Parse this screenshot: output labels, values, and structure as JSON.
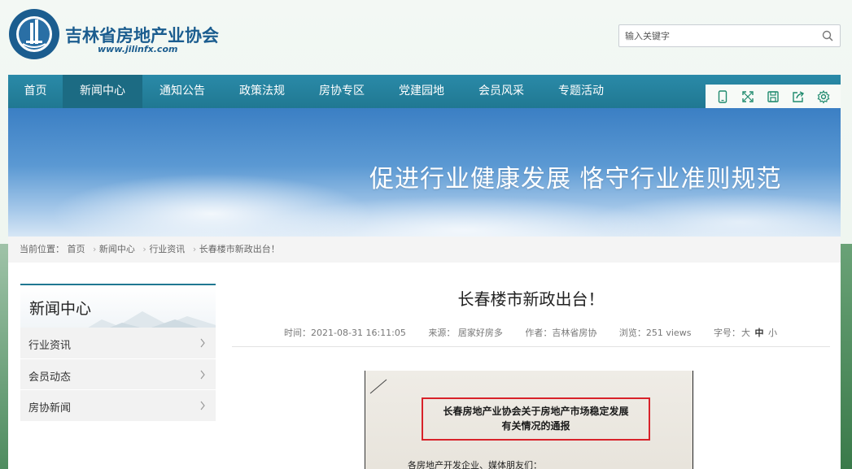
{
  "header": {
    "site_title": "吉林省房地产业协会",
    "site_url": "www.jilinfx.com",
    "search_placeholder": "输入关键字"
  },
  "nav": {
    "items": [
      {
        "label": "首页"
      },
      {
        "label": "新闻中心",
        "active": true
      },
      {
        "label": "通知公告"
      },
      {
        "label": "政策法规"
      },
      {
        "label": "房协专区"
      },
      {
        "label": "党建园地"
      },
      {
        "label": "会员风采"
      },
      {
        "label": "专题活动"
      }
    ],
    "tools": [
      "mobile-icon",
      "fullscreen-icon",
      "save-icon",
      "share-icon",
      "settings-icon"
    ]
  },
  "banner": {
    "slogan": "促进行业健康发展 恪守行业准则规范"
  },
  "breadcrumb": {
    "prefix": "当前位置：",
    "items": [
      "首页",
      "新闻中心",
      "行业资讯",
      "长春楼市新政出台！"
    ]
  },
  "sidebar": {
    "title": "新闻中心",
    "items": [
      "行业资讯",
      "会员动态",
      "房协新闻"
    ]
  },
  "article": {
    "title": "长春楼市新政出台！",
    "time": "时间：2021-08-31 16:11:05",
    "source": "来源： 居家好房多",
    "author": "作者：吉林省房协",
    "views": "浏览：251 views",
    "font_size_label": "字号：",
    "font_sizes": [
      "大",
      "中",
      "小"
    ],
    "doc_heading_line1": "长春房地产业协会关于房地产市场稳定发展",
    "doc_heading_line2": "有关情况的通报",
    "doc_greeting": "各房地产开发企业、媒体朋友们："
  },
  "colors": {
    "brand": "#1b5d8f",
    "nav": "#207892",
    "highlight_box": "#d8222a"
  }
}
